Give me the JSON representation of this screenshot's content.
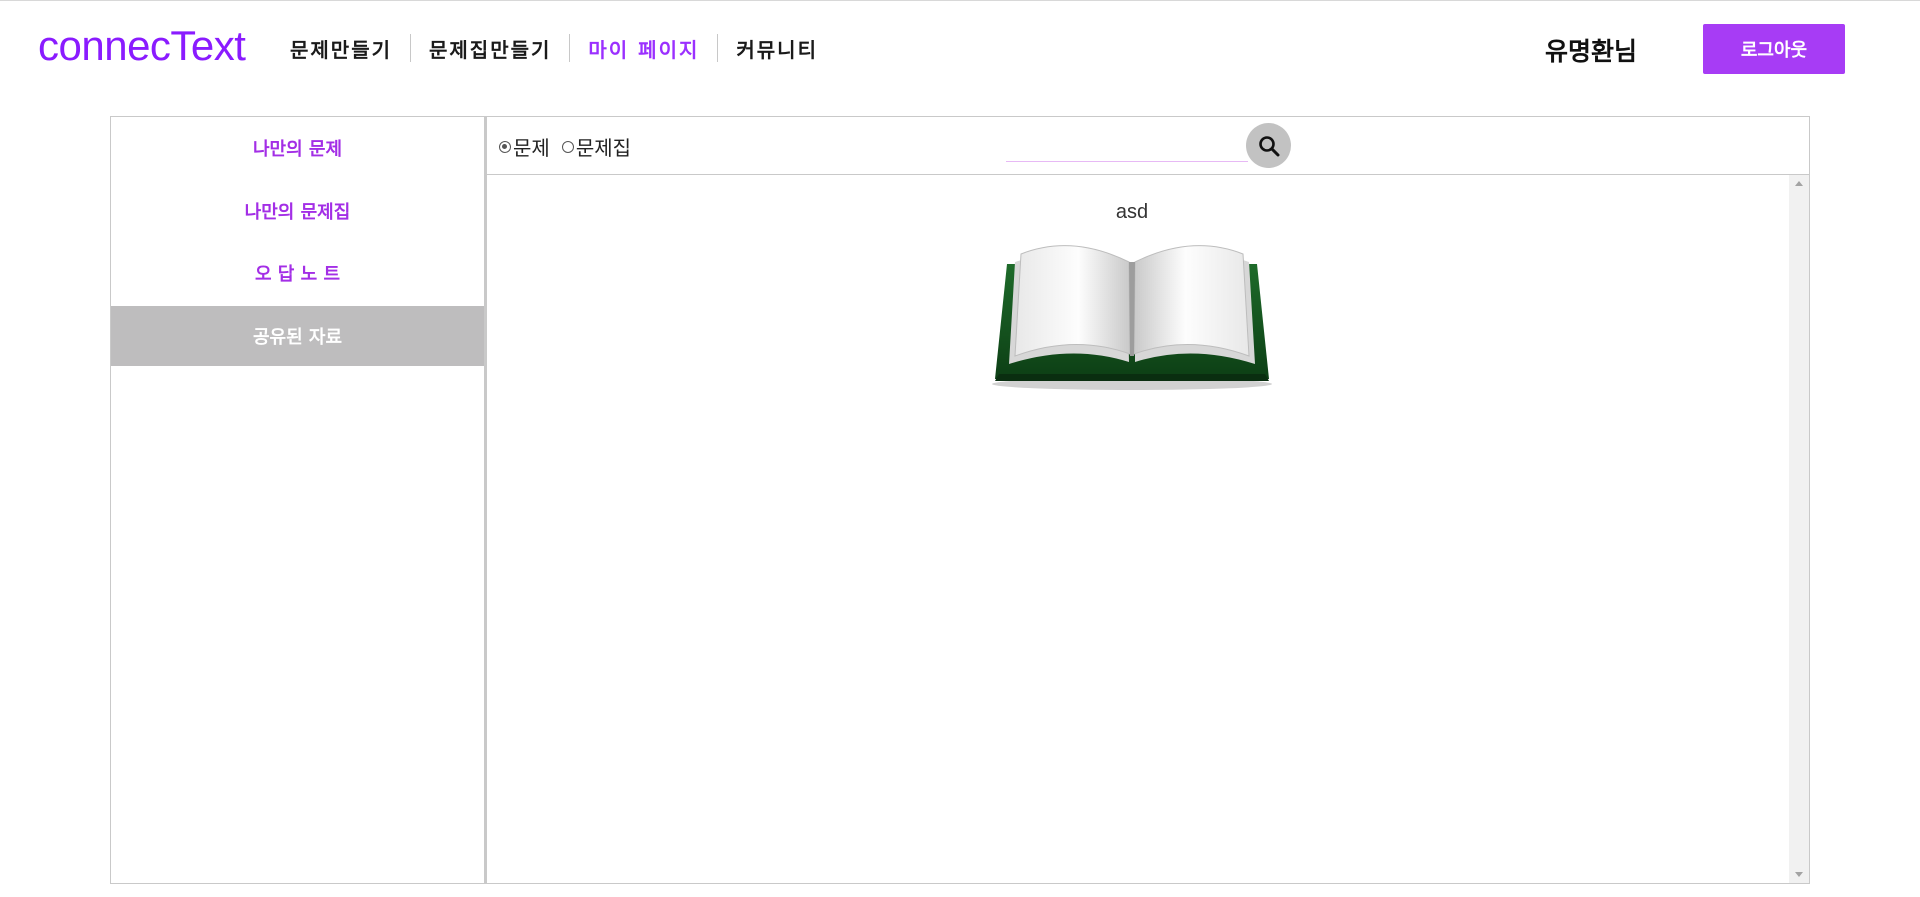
{
  "header": {
    "logo": "connecText",
    "nav": [
      {
        "label": "문제만들기"
      },
      {
        "label": "문제집만들기"
      },
      {
        "label": "마이 페이지"
      },
      {
        "label": "커뮤니티"
      }
    ],
    "active_nav": "마이 페이지",
    "username": "유명환님",
    "logout_label": "로그아웃"
  },
  "sidebar": {
    "items": [
      {
        "label": "나만의 문제"
      },
      {
        "label": "나만의 문제집"
      },
      {
        "label": "오 답 노 트"
      },
      {
        "label": "공유된 자료"
      }
    ],
    "active_item": "공유된 자료"
  },
  "filter": {
    "options": [
      {
        "label": "문제",
        "checked": true
      },
      {
        "label": "문제집",
        "checked": false
      }
    ],
    "search_value": "",
    "search_icon": "search-icon"
  },
  "items": [
    {
      "title": "asd",
      "icon": "open-book-icon"
    }
  ],
  "colors": {
    "brand": "#8a1bff",
    "accent": "#a73cf5",
    "active_sidebar_bg": "#bebdbe",
    "sidebar_text": "#a32ee6"
  }
}
